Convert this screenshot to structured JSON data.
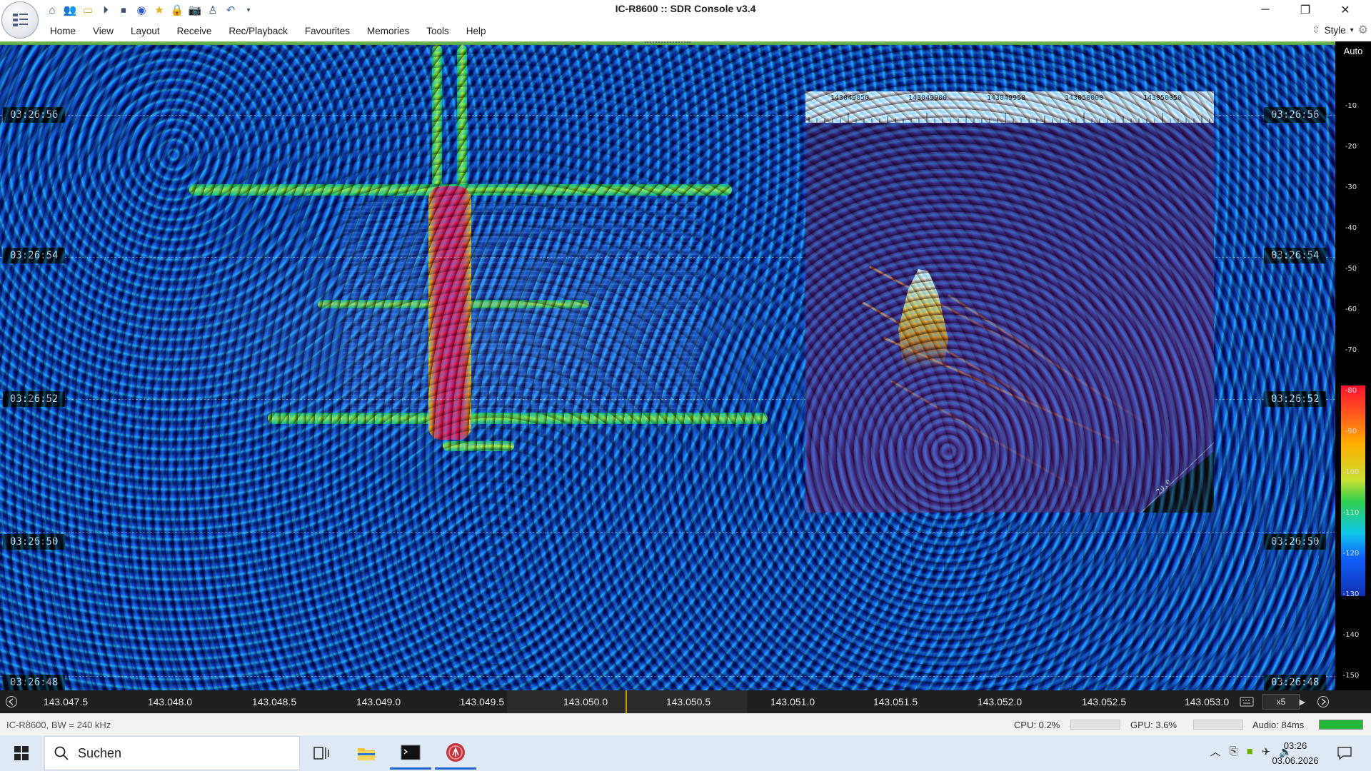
{
  "window": {
    "title": "IC-R8600 :: SDR Console v3.4",
    "minimize_glyph": "─",
    "restore_glyph": "❐",
    "close_glyph": "✕"
  },
  "menu": {
    "items": [
      "Home",
      "View",
      "Layout",
      "Receive",
      "Rec/Playback",
      "Favourites",
      "Memories",
      "Tools",
      "Help"
    ],
    "style_label": "Style"
  },
  "waterfall": {
    "times": [
      "03:26:56",
      "03:26:54",
      "03:26:52",
      "03:26:50",
      "03:26:48"
    ]
  },
  "spectrum3d": {
    "ruler_labels": [
      "143049850",
      "143049900",
      "143049950",
      "143050000",
      "143050050"
    ],
    "axis_tick": "20.0"
  },
  "dbscale": {
    "auto_label": "Auto",
    "labels": [
      "-10",
      "-20",
      "-30",
      "-40",
      "-50",
      "-60",
      "-70",
      "-80",
      "-90",
      "-100",
      "-110",
      "-120",
      "-130",
      "-140",
      "-150"
    ]
  },
  "freqbar": {
    "labels": [
      "143.047.5",
      "143.048.0",
      "143.048.5",
      "143.049.0",
      "143.049.5",
      "143.050.0",
      "143.050.5",
      "143.051.0",
      "143.051.5",
      "143.052.0",
      "143.052.5",
      "143.053.0"
    ],
    "zoom": "x5"
  },
  "status": {
    "device": "IC-R8600, BW = 240 kHz",
    "cpu": "CPU: 0.2%",
    "gpu": "GPU: 3.6%",
    "audio": "Audio: 84ms"
  },
  "taskbar": {
    "search_placeholder": "Suchen",
    "time": "03:26",
    "date": "03.06.2026"
  },
  "colors": {
    "accent_green": "#4f9f3a",
    "center_marker": "#c8a000",
    "audio_meter": "#25b93a",
    "taskbar_active": "#1f63d6"
  }
}
